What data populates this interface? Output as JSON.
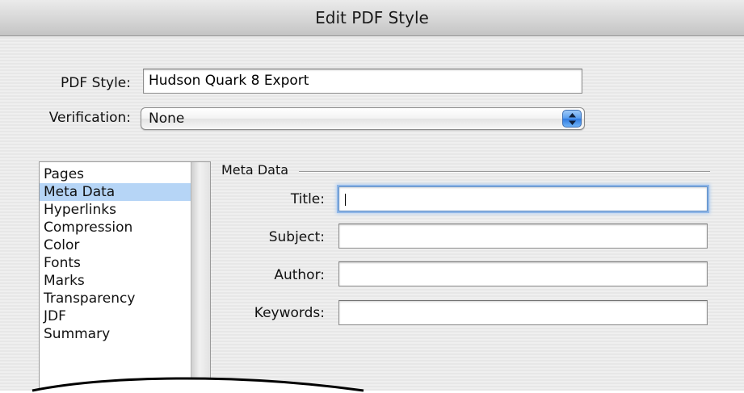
{
  "window": {
    "title": "Edit PDF Style"
  },
  "pdf_style": {
    "label": "PDF Style:",
    "value": "Hudson Quark 8 Export"
  },
  "verification": {
    "label": "Verification:",
    "selected": "None"
  },
  "categories": [
    {
      "label": "Pages",
      "selected": false
    },
    {
      "label": "Meta Data",
      "selected": true
    },
    {
      "label": "Hyperlinks",
      "selected": false
    },
    {
      "label": "Compression",
      "selected": false
    },
    {
      "label": "Color",
      "selected": false
    },
    {
      "label": "Fonts",
      "selected": false
    },
    {
      "label": "Marks",
      "selected": false
    },
    {
      "label": "Transparency",
      "selected": false
    },
    {
      "label": "JDF",
      "selected": false
    },
    {
      "label": "Summary",
      "selected": false
    }
  ],
  "meta_data": {
    "group_label": "Meta Data",
    "title": {
      "label": "Title:",
      "value": ""
    },
    "subject": {
      "label": "Subject:",
      "value": ""
    },
    "author": {
      "label": "Author:",
      "value": ""
    },
    "keywords": {
      "label": "Keywords:",
      "value": ""
    }
  },
  "colors": {
    "selection": "#b6d5f6",
    "focus_ring": "#8fb6e6",
    "popup_button": "#4f94ea"
  }
}
